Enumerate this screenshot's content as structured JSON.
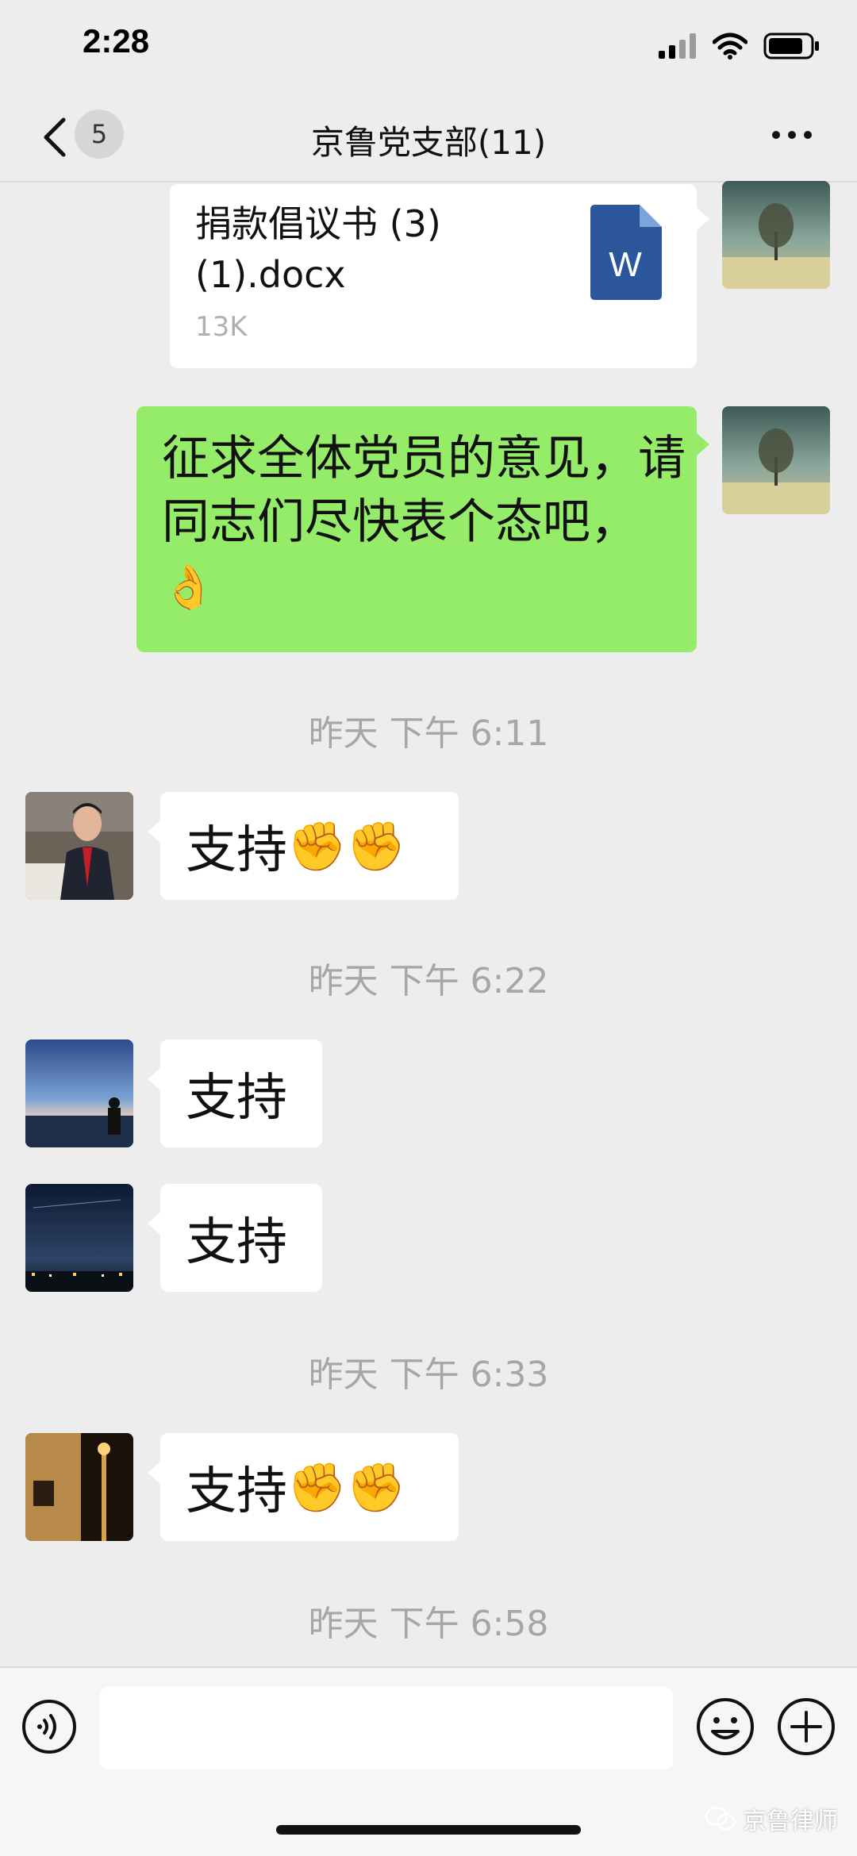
{
  "status_bar": {
    "time": "2:28"
  },
  "nav": {
    "unread_count": "5",
    "title": "京鲁党支部(11)"
  },
  "messages": {
    "file": {
      "name_line1": "捐款倡议书 (3)",
      "name_line2": "(1).docx",
      "size": "13K",
      "icon_letter": "W"
    },
    "green": {
      "text": "征求全体党员的意见，请同志们尽快表个态吧，",
      "emoji": "👌"
    },
    "t1": "昨天 下午 6:11",
    "m1": {
      "text": "支持",
      "emoji": "✊✊"
    },
    "t2": "昨天 下午 6:22",
    "m2": {
      "text": "支持"
    },
    "m3": {
      "text": "支持"
    },
    "t3": "昨天 下午 6:33",
    "m4": {
      "text": "支持",
      "emoji": "✊✊"
    },
    "t4": "昨天 下午 6:58"
  },
  "watermark": {
    "text": "京鲁律师"
  },
  "colors": {
    "green_bubble": "#95ec69",
    "background": "#ededed",
    "word_blue": "#2b579a"
  }
}
